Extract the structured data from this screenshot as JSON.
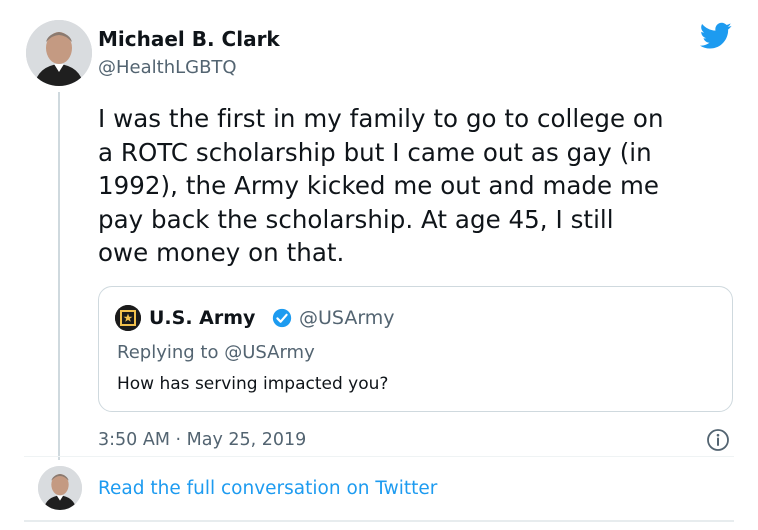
{
  "tweet": {
    "author_name": "Michael B. Clark",
    "author_handle": "@HealthLGBTQ",
    "text_lines": [
      "I was the first in my family to go to college on",
      "a ROTC scholarship but I came out as gay (in",
      "1992), the Army kicked me out and made me",
      "pay back the scholarship. At age 45, I still",
      "owe money on that."
    ],
    "timestamp": "3:50 AM · May 25, 2019",
    "read_more": "Read the full conversation on Twitter",
    "brand_icon": "twitter-bird-icon",
    "accent_color": "#1d9bf0"
  },
  "quoted": {
    "author_name": "U.S. Army",
    "author_handle": "@USArmy",
    "replying_to": "Replying to @USArmy",
    "text": "How has serving impacted you?",
    "verified": true,
    "logo_text": "U.S.ARMY"
  }
}
